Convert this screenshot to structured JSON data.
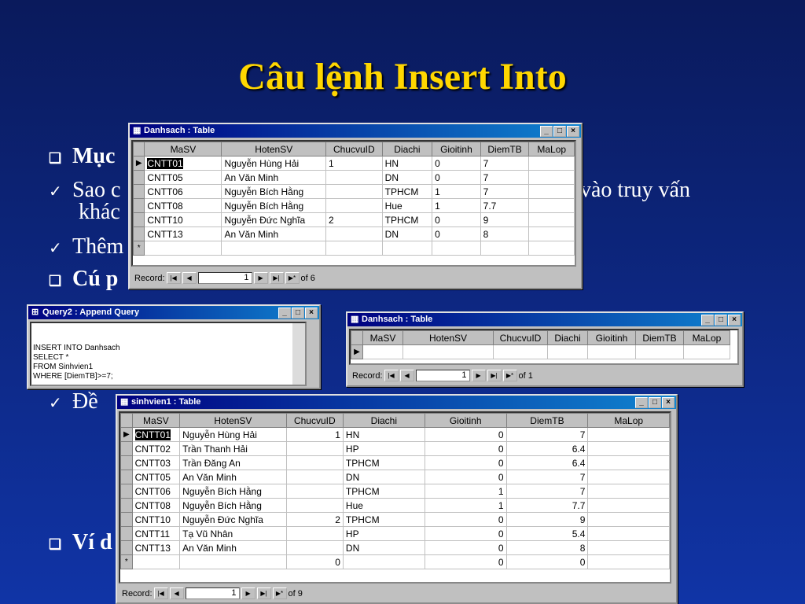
{
  "slide": {
    "title": "Câu lệnh Insert Into",
    "bullets": {
      "b1": "Mục",
      "b2": "Sao c",
      "b2_tail": "vào truy vấn",
      "b2b": "khác",
      "b3": "Thêm",
      "b4": "Cú p",
      "b5": "Đề",
      "b6": "Ví d"
    }
  },
  "danhsach_top": {
    "title": "Danhsach : Table",
    "columns": [
      "MaSV",
      "HotenSV",
      "ChucvuID",
      "Diachi",
      "Gioitinh",
      "DiemTB",
      "MaLop"
    ],
    "rows": [
      [
        "CNTT01",
        "Nguyễn Hùng Hải",
        "1",
        "HN",
        "0",
        "7",
        ""
      ],
      [
        "CNTT05",
        "An Văn Minh",
        "",
        "DN",
        "0",
        "7",
        ""
      ],
      [
        "CNTT06",
        "Nguyễn Bích Hằng",
        "",
        "TPHCM",
        "1",
        "7",
        ""
      ],
      [
        "CNTT08",
        "Nguyễn Bích Hằng",
        "",
        "Hue",
        "1",
        "7.7",
        ""
      ],
      [
        "CNTT10",
        "Nguyễn Đức Nghĩa",
        "2",
        "TPHCM",
        "0",
        "9",
        ""
      ],
      [
        "CNTT13",
        "An Văn Minh",
        "",
        "DN",
        "0",
        "8",
        ""
      ]
    ],
    "record_label": "Record:",
    "record_value": "1",
    "record_of": "of  6"
  },
  "query2": {
    "title": "Query2 : Append Query",
    "sql": "INSERT INTO Danhsach\nSELECT *\nFROM Sinhvien1\nWHERE [DiemTB]>=7;"
  },
  "danhsach_empty": {
    "title": "Danhsach : Table",
    "columns": [
      "MaSV",
      "HotenSV",
      "ChucvuID",
      "Diachi",
      "Gioitinh",
      "DiemTB",
      "MaLop"
    ],
    "record_label": "Record:",
    "record_value": "1",
    "record_of": "of  1"
  },
  "sinhvien1": {
    "title": "sinhvien1 : Table",
    "columns": [
      "MaSV",
      "HotenSV",
      "ChucvuID",
      "Diachi",
      "Gioitinh",
      "DiemTB",
      "MaLop"
    ],
    "rows": [
      [
        "CNTT01",
        "Nguyễn Hùng Hải",
        "1",
        "HN",
        "0",
        "7",
        ""
      ],
      [
        "CNTT02",
        "Trần Thanh Hải",
        "",
        "HP",
        "0",
        "6.4",
        ""
      ],
      [
        "CNTT03",
        "Trần Đăng An",
        "",
        "TPHCM",
        "0",
        "6.4",
        ""
      ],
      [
        "CNTT05",
        "An Văn Minh",
        "",
        "DN",
        "0",
        "7",
        ""
      ],
      [
        "CNTT06",
        "Nguyễn Bích Hằng",
        "",
        "TPHCM",
        "1",
        "7",
        ""
      ],
      [
        "CNTT08",
        "Nguyễn Bích Hằng",
        "",
        "Hue",
        "1",
        "7.7",
        ""
      ],
      [
        "CNTT10",
        "Nguyễn Đức Nghĩa",
        "2",
        "TPHCM",
        "0",
        "9",
        ""
      ],
      [
        "CNTT11",
        "Tạ Vũ Nhân",
        "",
        "HP",
        "0",
        "5.4",
        ""
      ],
      [
        "CNTT13",
        "An Văn Minh",
        "",
        "DN",
        "0",
        "8",
        ""
      ]
    ],
    "new_row": [
      "",
      "",
      "0",
      "",
      "0",
      "0",
      ""
    ],
    "record_label": "Record:",
    "record_value": "1",
    "record_of": "of  9"
  },
  "window_buttons": {
    "minimize": "_",
    "maximize": "□",
    "close": "×"
  },
  "nav_glyphs": {
    "first": "|◀",
    "prev": "◀",
    "next": "▶",
    "last": "▶|",
    "new": "▶*"
  },
  "icons": {
    "table": "▦",
    "query": "⊞",
    "row_pointer": "▶",
    "new_row": "*"
  }
}
